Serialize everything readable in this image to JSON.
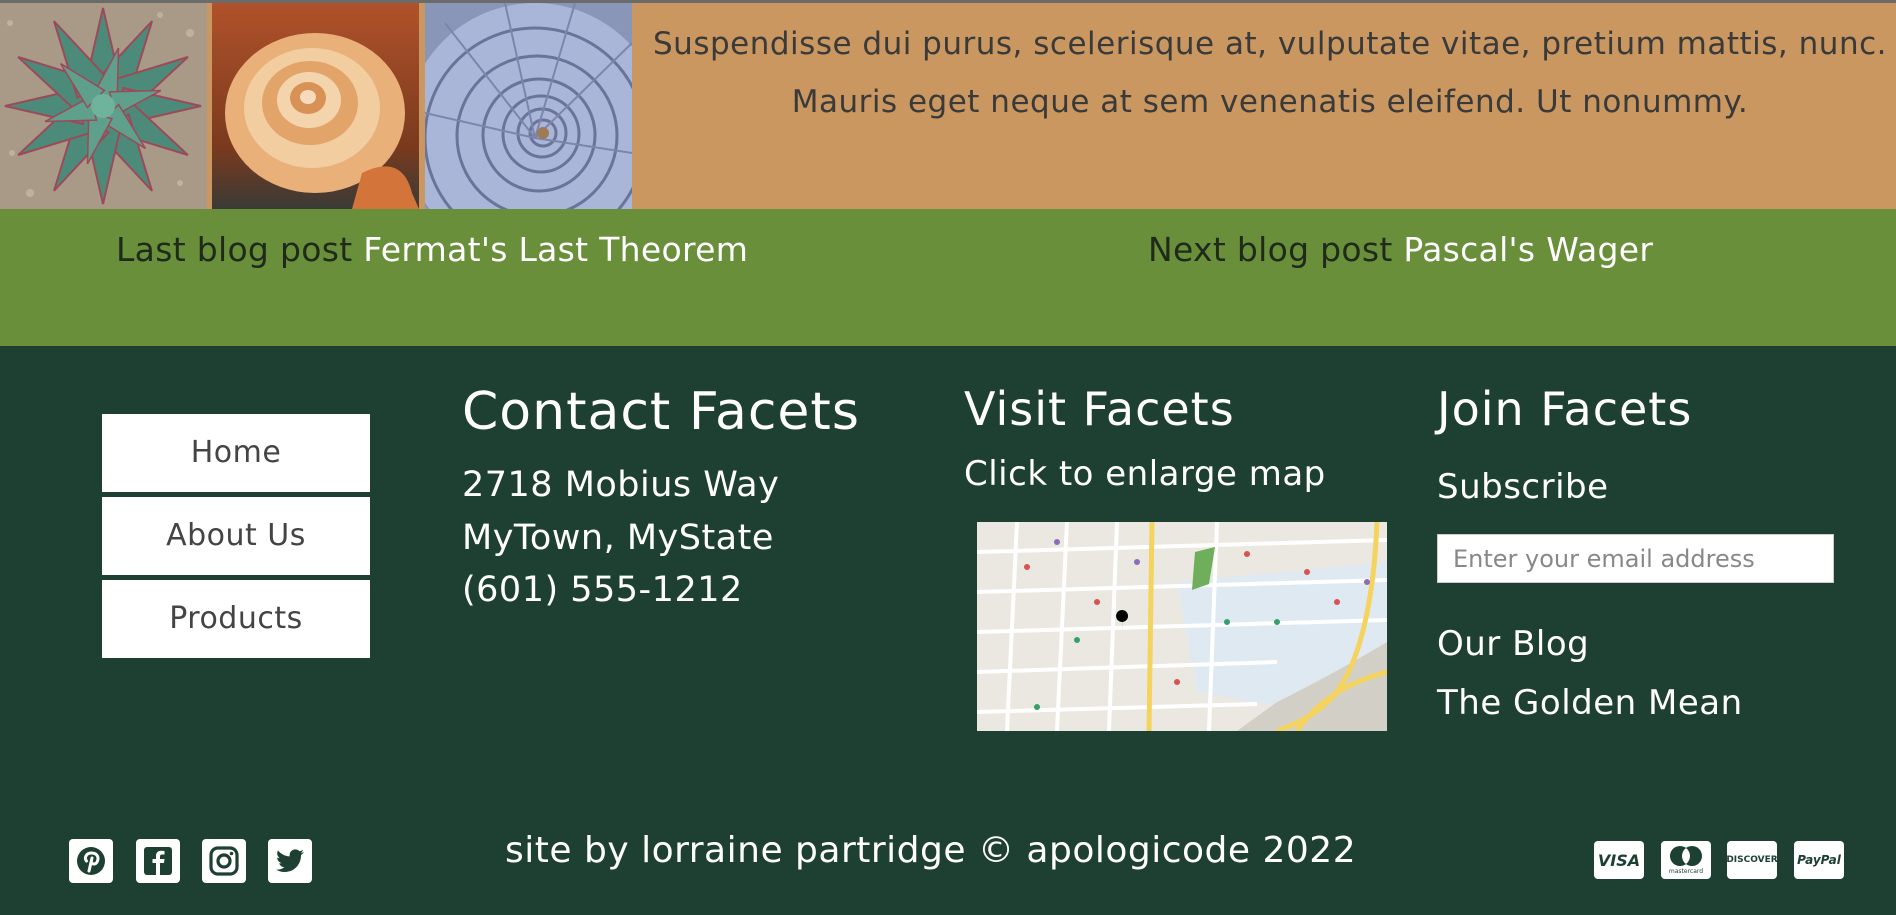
{
  "header": {
    "intro_text": "Suspendisse dui purus, scelerisque at, vulputate vitae, pretium mattis, nunc. Mauris eget neque at sem venenatis eleifend. Ut nonummy.",
    "images": [
      "succulent-photo",
      "conch-shell-photo",
      "nautilus-shell-photo"
    ]
  },
  "postnav": {
    "prev_label": "Last blog post",
    "prev_title": "Fermat's Last Theorem",
    "next_label": "Next blog post",
    "next_title": "Pascal's Wager"
  },
  "menu": {
    "items": [
      {
        "label": "Home"
      },
      {
        "label": "About Us"
      },
      {
        "label": "Products"
      }
    ]
  },
  "contact": {
    "title": "Contact Facets",
    "address1": "2718 Mobius Way",
    "address2": "MyTown, MyState",
    "phone": "(601) 555-1212"
  },
  "visit": {
    "title": "Visit Facets",
    "subtitle": "Click to enlarge map"
  },
  "join": {
    "title": "Join Facets",
    "subscribe": "Subscribe",
    "email_placeholder": "Enter your email address",
    "blog_link": "Our Blog",
    "golden_link": "The Golden Mean"
  },
  "footer": {
    "credit": "site by lorraine partridge © apologicode 2022",
    "social_icons": [
      "pinterest-icon",
      "facebook-icon",
      "instagram-icon",
      "twitter-icon"
    ],
    "payment_icons": [
      "visa-icon",
      "mastercard-icon",
      "discover-icon",
      "paypal-icon"
    ],
    "payment_labels": {
      "visa": "VISA",
      "mastercard": "mastercard",
      "discover": "DISCOVER",
      "paypal": "PayPal"
    }
  },
  "colors": {
    "header_bg": "#c9975f",
    "postnav_bg": "#6a8f3a",
    "footer_bg": "#1d4032"
  }
}
